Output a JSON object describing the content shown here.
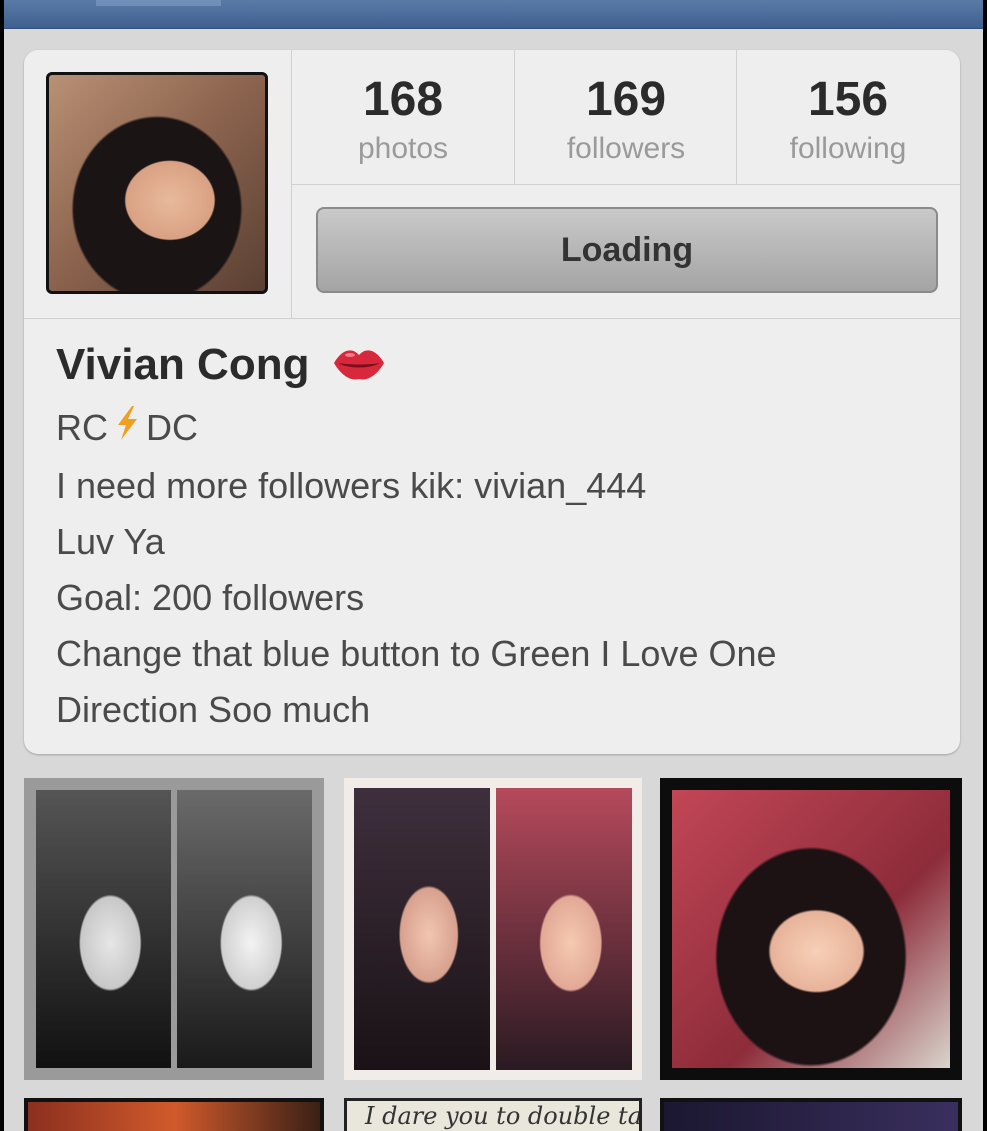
{
  "stats": [
    {
      "count": "168",
      "label": "photos"
    },
    {
      "count": "169",
      "label": "followers"
    },
    {
      "count": "156",
      "label": "following"
    }
  ],
  "follow_button": {
    "label": "Loading"
  },
  "profile": {
    "name": "Vivian Cong",
    "name_emoji": "lips-icon",
    "bio": {
      "line1_left": "RC",
      "line1_icon": "lightning-bolt-icon",
      "line1_right": "DC",
      "line2": "I need more followers kik: vivian_444",
      "line3": "Luv Ya",
      "line4": "Goal: 200 followers",
      "line5": "Change that blue button to Green I Love One",
      "line6": "Direction Soo much"
    }
  },
  "grid": {
    "photo_caption_partial": "I dare you to double tap"
  },
  "colors": {
    "topbar": "#3f6090",
    "card": "#eeeeee",
    "bolt": "#f0a020",
    "lips": "#d8283c"
  }
}
